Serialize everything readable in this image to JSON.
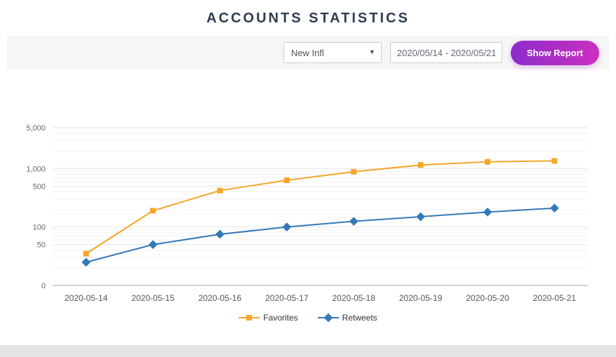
{
  "page": {
    "title": "ACCOUNTS STATISTICS"
  },
  "toolbar": {
    "filter_select": {
      "value": "New Infl"
    },
    "date_range": {
      "value": "2020/05/14 - 2020/05/21"
    },
    "show_report_label": "Show Report"
  },
  "theme": {
    "title_color": "#2f3d52",
    "button_gradient": [
      "#8d2ccb",
      "#cb2fc0"
    ],
    "toolbar_bg": "#f6f6f7",
    "page_bg": "#e4e4e4",
    "favorites_color": "#f5a62a",
    "retweets_color": "#3579b8"
  },
  "chart_data": {
    "type": "line",
    "title": "",
    "xlabel": "",
    "ylabel": "",
    "grid": true,
    "legend_position": "bottom",
    "categories": [
      "2020-05-14",
      "2020-05-15",
      "2020-05-16",
      "2020-05-17",
      "2020-05-18",
      "2020-05-19",
      "2020-05-20",
      "2020-05-21"
    ],
    "series": [
      {
        "name": "Favorites",
        "color": "#f5a62a",
        "marker": "square",
        "values": [
          35,
          190,
          420,
          630,
          880,
          1150,
          1300,
          1350
        ]
      },
      {
        "name": "Retweets",
        "color": "#3579b8",
        "marker": "diamond",
        "values": [
          25,
          50,
          75,
          100,
          125,
          150,
          180,
          210
        ]
      }
    ],
    "yaxis": {
      "scale": "log",
      "min": 0,
      "max": 5000,
      "ticks": [
        0,
        50,
        100,
        500,
        1000,
        5000
      ],
      "tick_labels": [
        "0",
        "50",
        "100",
        "500",
        "1,000",
        "5,000"
      ]
    }
  }
}
